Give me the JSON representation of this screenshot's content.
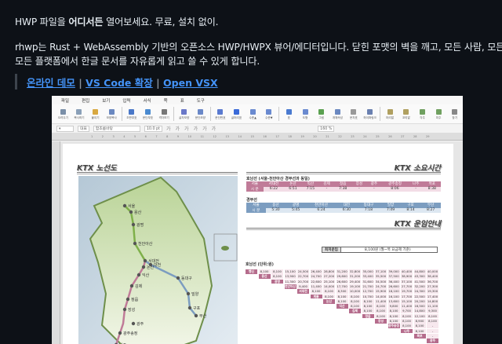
{
  "readme": {
    "line1_pre": "HWP 파일을 ",
    "line1_bold": "어디서든",
    "line1_post": " 열어보세요. 무료, 설치 없이.",
    "para_line1": "rhwp는 Rust + WebAssembly 기반의 오픈소스 HWP/HWPX 뷰어/에디터입니다. 닫힌 포맷의 벽을 깨고, 모든 사람, 모든 AI,",
    "para_line2": "모든 플랫폼에서 한글 문서를 자유롭게 읽고 쓸 수 있게 합니다.",
    "links": [
      "온라인 데모",
      "VS Code 확장",
      "Open VSX"
    ],
    "sep": "|"
  },
  "editor": {
    "menu": [
      "파일",
      "편집",
      "보기",
      "입력",
      "서식",
      "쪽",
      "표",
      "도구"
    ],
    "toolbar": [
      "오려두기",
      "복사하기",
      "붙이기",
      "모양복사",
      "조판부호",
      "문단부호",
      "격자보기",
      "글자모양",
      "문단모양",
      "문단번호",
      "글머리표",
      "수준▲",
      "수준▼",
      "표",
      "도형",
      "그림",
      "개체속성",
      "문자표",
      "하이퍼링크",
      "머리말",
      "꼬리말",
      "각주",
      "미주",
      "찾기"
    ],
    "style": "대표",
    "font": "함초롬바탕",
    "size": "10.0",
    "unit": "pt",
    "char_btns": [
      "가",
      "가",
      "가",
      "가",
      "가",
      "가"
    ],
    "zoom": "160 %",
    "ruler": [
      "1",
      "2",
      "3",
      "4",
      "5",
      "6",
      "7",
      "8",
      "9",
      "10",
      "11",
      "12",
      "13",
      "14",
      "15",
      "16",
      "17",
      "18",
      "19",
      "20",
      "21",
      "22",
      "23",
      "24",
      "25",
      "26",
      "27",
      "28",
      "29"
    ]
  },
  "doc": {
    "map_title": "KTX 노선도",
    "time_title": "KTX 소요시간",
    "honam_label": "호남선 (서울-천안아산 경부선과 동일)",
    "honam_head": [
      "서울",
      "서대전",
      "논산",
      "익산",
      "김제",
      "정읍",
      "장성",
      "광주",
      "광주송정",
      "나주",
      "목포"
    ],
    "honam_row": [
      "시 분",
      "6:22",
      "6:51",
      "7:15",
      "-",
      "7:38",
      "-",
      "-",
      "8:06",
      "-",
      "8:38"
    ],
    "gyeongbu_label": "경부선",
    "gyeongbu_head": [
      "서울",
      "용산",
      "광명",
      "천안아산",
      "대전",
      "동대구",
      "밀양",
      "구포",
      "부산"
    ],
    "gyeongbu_row": [
      "시 분",
      "5:30",
      "5:45",
      "6:24",
      "6:30",
      "7:18",
      "7:49",
      "8:14",
      "8:27"
    ],
    "fare_title": "KTX 운임안내",
    "min_fare_label": "최저운임",
    "min_fare_value": "8,100원 (월~목 요금제 기준)",
    "fare_label": "호남선 (단위:원)",
    "fare_stations": [
      "행신",
      "용산",
      "광명",
      "천안아산",
      "서대전",
      "계룡",
      "논산",
      "익산",
      "김제",
      "정읍",
      "장성",
      "광주송정",
      "나주",
      "목포",
      "광주"
    ],
    "fare_rows": [
      [
        "8,100",
        "8,100",
        "15,100",
        "24,500",
        "26,400",
        "28,800",
        "31,200",
        "32,800",
        "35,000",
        "37,100",
        "39,000",
        "40,400",
        "44,800",
        "40,000"
      ],
      [
        "8,100",
        "13,900",
        "22,700",
        "24,700",
        "27,200",
        "29,600",
        "31,200",
        "33,400",
        "35,500",
        "37,500",
        "38,900",
        "43,300",
        "38,400"
      ],
      [
        "11,300",
        "20,700",
        "22,600",
        "25,100",
        "26,600",
        "29,400",
        "31,600",
        "34,500",
        "36,400",
        "37,100",
        "41,500",
        "36,700"
      ],
      [
        "9,400",
        "11,400",
        "14,000",
        "17,700",
        "19,100",
        "21,700",
        "24,700",
        "26,600",
        "27,700",
        "32,200",
        "27,300"
      ],
      [
        "8,100",
        "8,100",
        "8,300",
        "10,000",
        "12,700",
        "15,900",
        "18,100",
        "19,700",
        "24,300",
        "19,300"
      ],
      [
        "8,100",
        "8,100",
        "8,100",
        "10,700",
        "14,000",
        "16,100",
        "17,700",
        "22,500",
        "17,400"
      ],
      [
        "8,100",
        "8,100",
        "8,100",
        "11,400",
        "13,600",
        "15,100",
        "20,200",
        "14,800"
      ],
      [
        "8,100",
        "8,100",
        "8,100",
        "9,800",
        "11,400",
        "16,500",
        "11,100"
      ],
      [
        "8,100",
        "8,100",
        "8,100",
        "9,700",
        "14,800",
        "9,300"
      ],
      [
        "8,100",
        "8,100",
        "8,100",
        "12,100",
        "8,100"
      ],
      [
        "8,100",
        "8,100",
        "8,900",
        "8,100"
      ],
      [
        "8,100",
        "8,100",
        "-"
      ],
      [
        "8,100",
        "-"
      ],
      [
        "-"
      ]
    ],
    "map_stations": [
      "서울",
      "용산",
      "광명",
      "천안아산",
      "대전",
      "서대전",
      "논산",
      "익산",
      "동대구",
      "김제",
      "정읍",
      "밀양",
      "구포",
      "장성",
      "부산",
      "광주",
      "광주송정",
      "나주"
    ]
  },
  "colors": {
    "bg": "#0d1117",
    "link": "#4493f8",
    "honam": "#c07b98",
    "gyeongbu": "#7c9dc0",
    "green": "#7fb04a"
  }
}
